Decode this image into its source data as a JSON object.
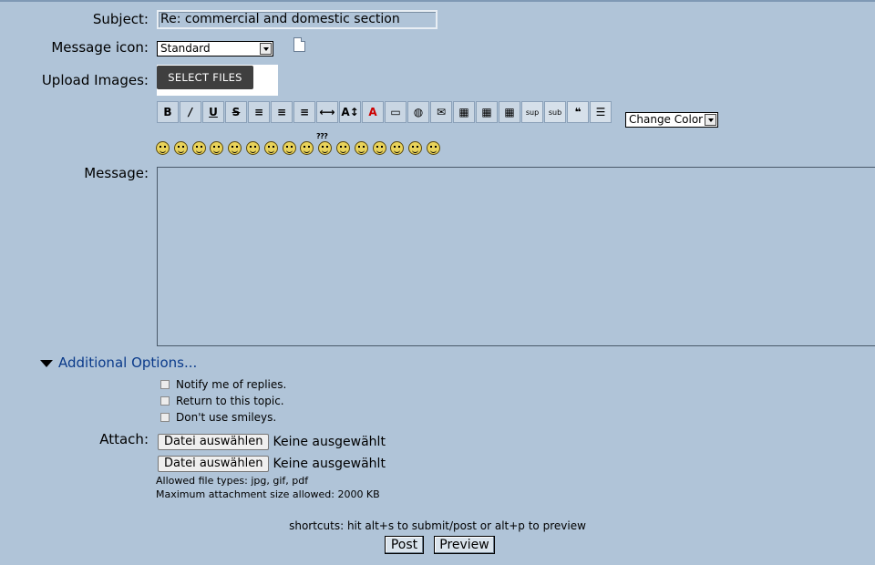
{
  "form": {
    "subject_label": "Subject:",
    "subject_value": "Re: commercial and domestic section",
    "message_icon_label": "Message icon:",
    "message_icon_value": "Standard",
    "upload_images_label": "Upload Images:",
    "select_files_label": "SELECT FILES",
    "change_color_label": "Change Color",
    "message_label": "Message:",
    "message_value": ""
  },
  "toolbar": {
    "buttons": [
      {
        "name": "bold",
        "glyph": "B"
      },
      {
        "name": "italic",
        "glyph": "/"
      },
      {
        "name": "underline",
        "glyph": "U"
      },
      {
        "name": "strikethrough",
        "glyph": "S"
      },
      {
        "name": "align-left",
        "glyph": "≡"
      },
      {
        "name": "align-center",
        "glyph": "≡"
      },
      {
        "name": "align-right",
        "glyph": "≡"
      },
      {
        "name": "horizontal-rule",
        "glyph": "⟷"
      },
      {
        "name": "font-size",
        "glyph": "A↕"
      },
      {
        "name": "font-color",
        "glyph": "A"
      },
      {
        "name": "insert-image",
        "glyph": "▭"
      },
      {
        "name": "insert-link",
        "glyph": "◍"
      },
      {
        "name": "insert-email",
        "glyph": "✉"
      },
      {
        "name": "table",
        "glyph": "▦"
      },
      {
        "name": "table-row",
        "glyph": "▦"
      },
      {
        "name": "table-cell",
        "glyph": "▦"
      },
      {
        "name": "superscript",
        "glyph": "sup"
      },
      {
        "name": "subscript",
        "glyph": "sub"
      },
      {
        "name": "quote",
        "glyph": "❝"
      },
      {
        "name": "list",
        "glyph": "☰"
      }
    ]
  },
  "smileys": {
    "count": 16,
    "confused_marker": "???"
  },
  "additional_options": {
    "toggle_label": "Additional Options...",
    "options": [
      {
        "label": "Notify me of replies.",
        "checked": false
      },
      {
        "label": "Return to this topic.",
        "checked": false
      },
      {
        "label": "Don't use smileys.",
        "checked": false
      }
    ]
  },
  "attach": {
    "label": "Attach:",
    "choose_file_label": "Datei auswählen",
    "no_file_text": "Keine ausgewählt",
    "allowed_types": "Allowed file types: jpg, gif, pdf",
    "max_size": "Maximum attachment size allowed: 2000 KB"
  },
  "footer": {
    "shortcuts": "shortcuts: hit alt+s to submit/post or alt+p to preview",
    "post_label": "Post",
    "preview_label": "Preview"
  }
}
